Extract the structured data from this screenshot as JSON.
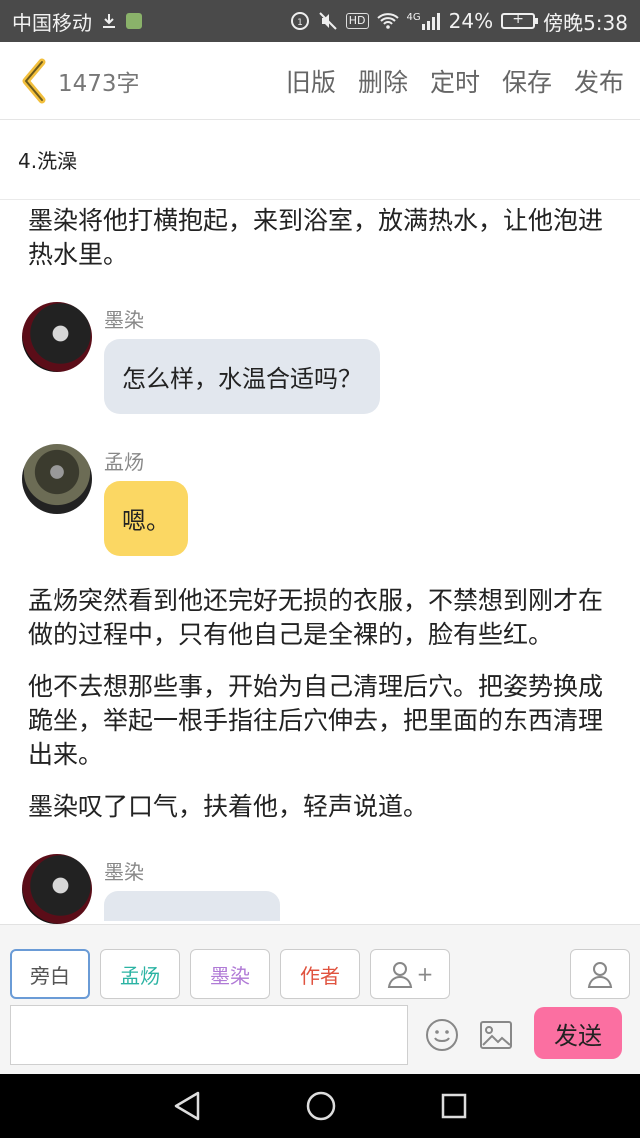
{
  "status_bar": {
    "carrier": "中国移动",
    "hd_badge": "HD",
    "network": "4G",
    "battery": "24%",
    "time": "傍晚5:38"
  },
  "app_bar": {
    "word_count": "1473字",
    "actions": [
      "旧版",
      "删除",
      "定时",
      "保存",
      "发布"
    ]
  },
  "chapter_title": "4.洗澡",
  "content": {
    "para1": "墨染将他打横抱起，来到浴室，放满热水，让他泡进热水里。",
    "msg1": {
      "speaker": "墨染",
      "text": "怎么样，水温合适吗？"
    },
    "msg2": {
      "speaker": "孟炀",
      "text": "嗯。"
    },
    "para2": "孟炀突然看到他还完好无损的衣服，不禁想到刚才在做的过程中，只有他自己是全裸的，脸有些红。",
    "para3": "他不去想那些事，开始为自己清理后穴。把姿势换成跪坐，举起一根手指往后穴伸去，把里面的东西清理出来。",
    "para4": "墨染叹了口气，扶着他，轻声说道。",
    "msg3": {
      "speaker": "墨染"
    }
  },
  "roles": {
    "narrator": "旁白",
    "char1": "孟炀",
    "char2": "墨染",
    "author": "作者",
    "add": "+"
  },
  "role_colors": {
    "narrator": "#555555",
    "char1": "#2bb3a3",
    "char2": "#b07ad6",
    "author": "#e0533f"
  },
  "input": {
    "value": "",
    "placeholder": ""
  },
  "send_label": "发送",
  "colors": {
    "bubble_gray": "#e2e7ee",
    "bubble_yellow": "#fbd763",
    "send_button": "#fb6fa1",
    "back_chevron": "#f2bf3c"
  }
}
